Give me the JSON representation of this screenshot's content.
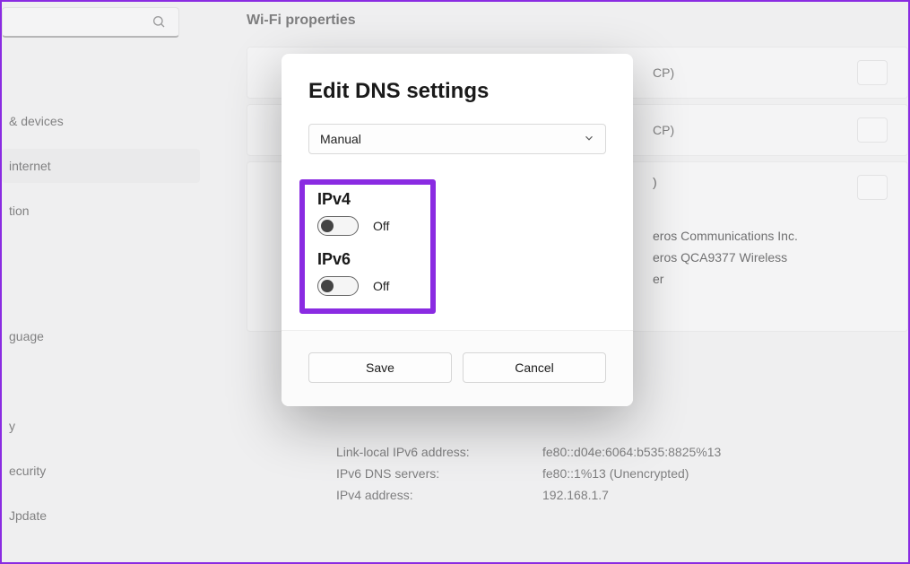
{
  "sidebar": {
    "search_placeholder": "",
    "items": [
      {
        "label": "& devices"
      },
      {
        "label": "internet"
      },
      {
        "label": "tion"
      },
      {
        "label": "guage"
      },
      {
        "label": "y"
      },
      {
        "label": "ecurity"
      },
      {
        "label": "Jpdate"
      }
    ]
  },
  "page": {
    "title": "Wi-Fi properties"
  },
  "rows": [
    {
      "suffix": "CP)"
    },
    {
      "suffix": "CP)"
    }
  ],
  "info": {
    "col1": ")",
    "vendor": "eros Communications Inc.",
    "adapter1": "eros QCA9377 Wireless",
    "adapter2": "er"
  },
  "details": [
    {
      "label": "Link-local IPv6 address:",
      "value": "fe80::d04e:6064:b535:8825%13"
    },
    {
      "label": "IPv6 DNS servers:",
      "value": "fe80::1%13 (Unencrypted)"
    },
    {
      "label": "IPv4 address:",
      "value": "192.168.1.7"
    }
  ],
  "dialog": {
    "title": "Edit DNS settings",
    "mode": "Manual",
    "ipv4": {
      "label": "IPv4",
      "state": "Off"
    },
    "ipv6": {
      "label": "IPv6",
      "state": "Off"
    },
    "save": "Save",
    "cancel": "Cancel"
  }
}
